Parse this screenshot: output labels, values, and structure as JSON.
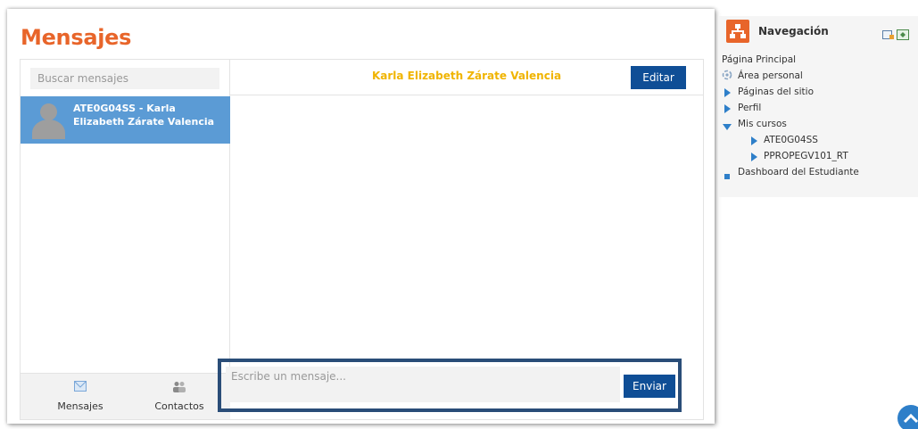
{
  "page": {
    "title": "Mensajes"
  },
  "messaging": {
    "search_placeholder": "Buscar mensajes",
    "conversations": [
      {
        "name": "ATE0G04SS - Karla Elizabeth Zárate Valencia"
      }
    ],
    "footer": {
      "messages_label": "Mensajes",
      "contacts_label": "Contactos"
    },
    "active_conversation": {
      "title": "Karla Elizabeth Zárate Valencia",
      "edit_label": "Editar"
    },
    "compose": {
      "placeholder": "Escribe un mensaje...",
      "send_label": "Enviar"
    }
  },
  "navigation": {
    "title": "Navegación",
    "items": [
      {
        "label": "Página Principal",
        "level": 0,
        "marker": "none"
      },
      {
        "label": "Área personal",
        "level": 1,
        "marker": "dashboard-icon"
      },
      {
        "label": "Páginas del sitio",
        "level": 1,
        "marker": "arrow-right"
      },
      {
        "label": "Perfil",
        "level": 1,
        "marker": "arrow-right"
      },
      {
        "label": "Mis cursos",
        "level": 1,
        "marker": "arrow-down"
      },
      {
        "label": "ATE0G04SS",
        "level": 2,
        "marker": "arrow-right"
      },
      {
        "label": "PPROPEGV101_RT",
        "level": 2,
        "marker": "arrow-right"
      },
      {
        "label": "Dashboard del Estudiante",
        "level": 1,
        "marker": "square"
      }
    ]
  },
  "colors": {
    "accent_orange": "#e8652a",
    "selected_blue": "#5b9bd5",
    "button_blue": "#0f4e96",
    "title_yellow": "#f0b400",
    "highlight_border": "#2a4d78"
  }
}
